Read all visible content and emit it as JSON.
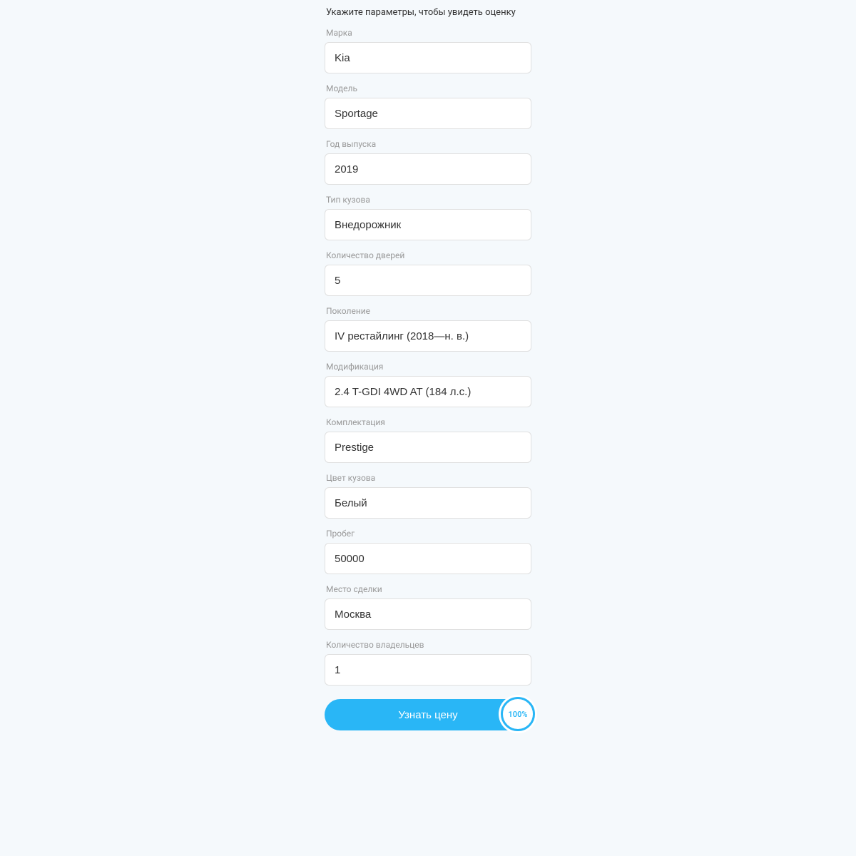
{
  "subtitle": "Укажите параметры, чтобы увидеть оценку",
  "fields": {
    "brand": {
      "label": "Марка",
      "value": "Kia"
    },
    "model": {
      "label": "Модель",
      "value": "Sportage"
    },
    "year": {
      "label": "Год выпуска",
      "value": "2019"
    },
    "body": {
      "label": "Тип кузова",
      "value": "Внедорожник"
    },
    "doors": {
      "label": "Количество дверей",
      "value": "5"
    },
    "generation": {
      "label": "Поколение",
      "value": "IV рестайлинг (2018—н. в.)"
    },
    "modification": {
      "label": "Модификация",
      "value": "2.4 T-GDI 4WD AT (184 л.с.)"
    },
    "trim": {
      "label": "Комплектация",
      "value": "Prestige"
    },
    "color": {
      "label": "Цвет кузова",
      "value": "Белый"
    },
    "mileage": {
      "label": "Пробег",
      "value": "50000"
    },
    "location": {
      "label": "Место сделки",
      "value": "Москва"
    },
    "owners": {
      "label": "Количество владельцев",
      "value": "1"
    }
  },
  "submit": {
    "label": "Узнать цену"
  },
  "progress": "100%"
}
